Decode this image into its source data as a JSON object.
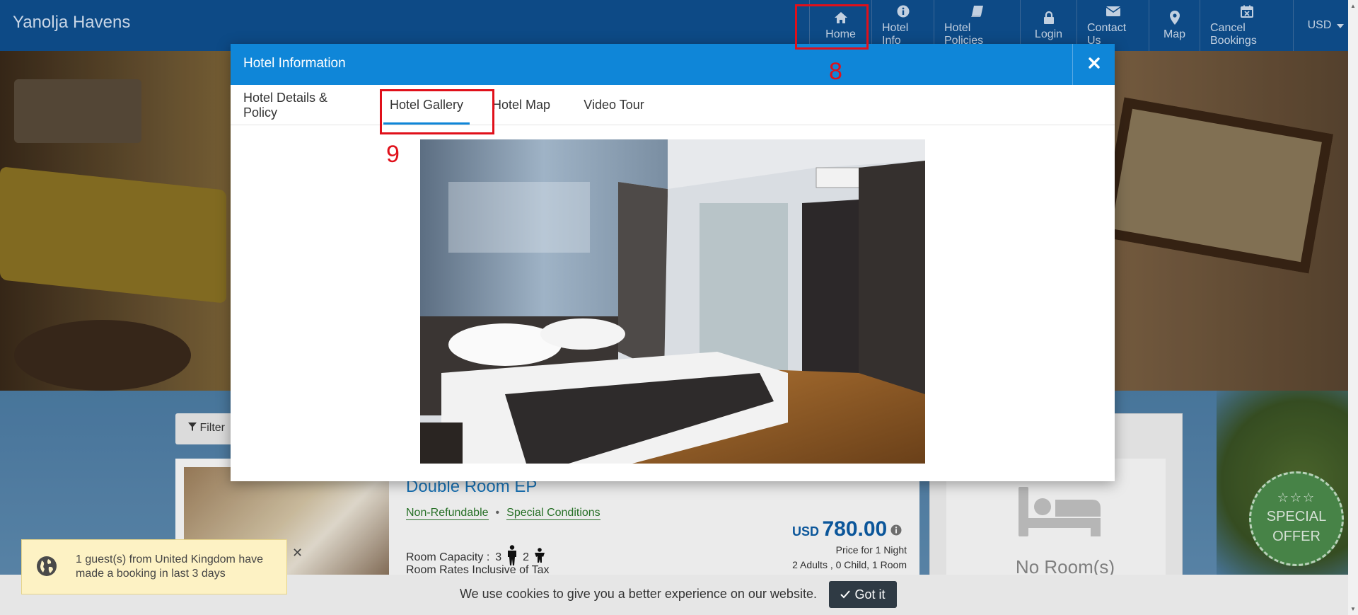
{
  "brand": "Yanolja Havens",
  "nav": {
    "home": "Home",
    "hotel_info": "Hotel Info",
    "hotel_policies": "Hotel Policies",
    "login": "Login",
    "contact_us": "Contact Us",
    "map": "Map",
    "cancel_bookings": "Cancel Bookings",
    "currency": "USD"
  },
  "modal": {
    "title": "Hotel Information",
    "tabs": [
      "Hotel Details & Policy",
      "Hotel Gallery",
      "Hotel Map",
      "Video Tour"
    ],
    "active_tab": "Hotel Gallery"
  },
  "annotations": {
    "a8": "8",
    "a9": "9"
  },
  "background": {
    "filter_label": "Filter",
    "room_title": "Double Room EP",
    "non_refundable": "Non-Refundable",
    "special_conditions": "Special Conditions",
    "room_capacity": "Room Capacity :",
    "adults_count": "3",
    "children_count": "2",
    "rates_tax": "Room Rates Inclusive of Tax",
    "price_currency": "USD",
    "price_amount": "780.00",
    "price_nights": "Price for 1 Night",
    "price_guests": "2 Adults , 0 Child, 1 Room",
    "no_rooms": "No Room(s)",
    "special_offer_line1": "SPECIAL",
    "special_offer_line2": "OFFER"
  },
  "toast": {
    "text": "1 guest(s) from United Kingdom have made a booking in last 3 days"
  },
  "cookie": {
    "text": "We use cookies to give you a better experience on our website.",
    "button": "Got it"
  },
  "colors": {
    "nav": "#0d4a86",
    "modal_header": "#0f86d8",
    "annotation": "#e0101a",
    "price": "#0d5ea8"
  }
}
